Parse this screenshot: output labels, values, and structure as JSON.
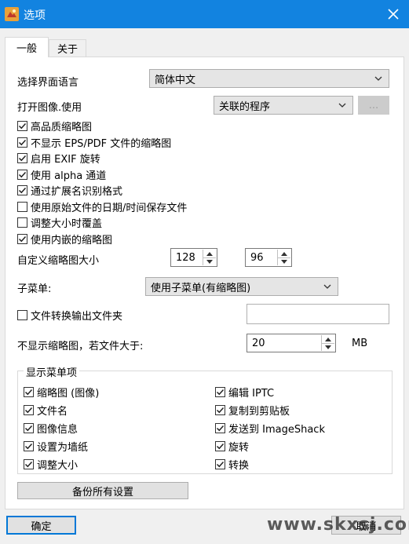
{
  "window": {
    "title": "选项"
  },
  "icons": {
    "app": "app-logo-icon",
    "close": "close-icon",
    "chevron": "chevron-down-icon",
    "checkmark": "checkmark-icon"
  },
  "tabs": [
    {
      "label": "一般",
      "active": true
    },
    {
      "label": "关于",
      "active": false
    }
  ],
  "language": {
    "label": "选择界面语言",
    "value": "简体中文"
  },
  "open_with": {
    "label": "打开图像.使用",
    "value": "关联的程序",
    "browse_label": "..."
  },
  "checks": [
    {
      "label": "高品质缩略图",
      "checked": true
    },
    {
      "label": "不显示 EPS/PDF 文件的缩略图",
      "checked": true
    },
    {
      "label": "启用 EXIF 旋转",
      "checked": true
    },
    {
      "label": "使用 alpha 通道",
      "checked": true
    },
    {
      "label": "通过扩展名识别格式",
      "checked": true
    },
    {
      "label": "使用原始文件的日期/时间保存文件",
      "checked": false
    },
    {
      "label": "调整大小时覆盖",
      "checked": false
    },
    {
      "label": "使用内嵌的缩略图",
      "checked": true
    }
  ],
  "thumb_size": {
    "label": "自定义缩略图大小",
    "width": "128",
    "height": "96"
  },
  "submenu": {
    "label": "子菜单:",
    "value": "使用子菜单(有缩略图)"
  },
  "convert_output": {
    "label": "文件转换输出文件夹",
    "checked": false,
    "value": ""
  },
  "size_limit": {
    "label": "不显示缩略图，若文件大于:",
    "value": "20",
    "unit": "MB"
  },
  "menu_items": {
    "legend": "显示菜单项",
    "left": [
      {
        "label": "缩略图 (图像)",
        "checked": true
      },
      {
        "label": "文件名",
        "checked": true
      },
      {
        "label": "图像信息",
        "checked": true
      },
      {
        "label": "设置为墙纸",
        "checked": true
      },
      {
        "label": "调整大小",
        "checked": true
      }
    ],
    "right": [
      {
        "label": "编辑 IPTC",
        "checked": true
      },
      {
        "label": "复制到剪贴板",
        "checked": true
      },
      {
        "label": "发送到 ImageShack",
        "checked": true
      },
      {
        "label": "旋转",
        "checked": true
      },
      {
        "label": "转换",
        "checked": true
      }
    ]
  },
  "backup_button": "备份所有设置",
  "ok_button": "确定",
  "cancel_button": "取消",
  "watermark": "www.skxsj.com"
}
